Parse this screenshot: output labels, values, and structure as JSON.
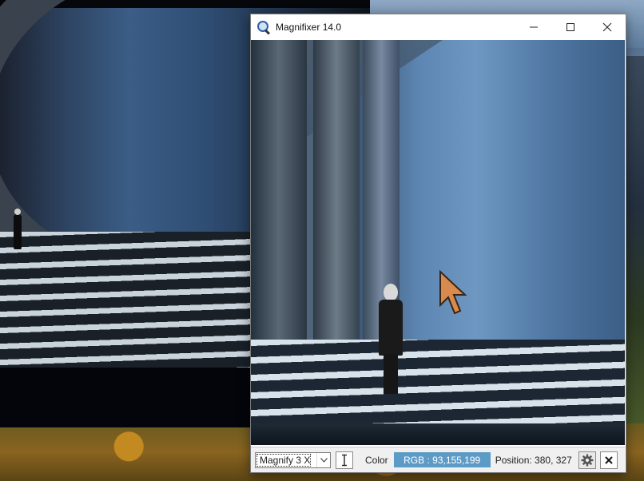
{
  "window": {
    "title": "Magnifixer 14.0",
    "controls": {
      "minimize": "minimize-icon",
      "maximize": "maximize-icon",
      "close": "close-icon"
    }
  },
  "statusbar": {
    "magnify_selected": "Magnify 3 X",
    "color_label": "Color",
    "rgb_value": "RGB : 93,155,199",
    "rgb_swatch_color": "#5d9bc7",
    "position_text": "Position: 380, 327"
  },
  "icons": {
    "app": "magnifier-icon",
    "text_cursor": "text-cursor-icon",
    "settings": "gear-icon",
    "exit": "close-icon",
    "pointer": "arrow-cursor-icon"
  }
}
